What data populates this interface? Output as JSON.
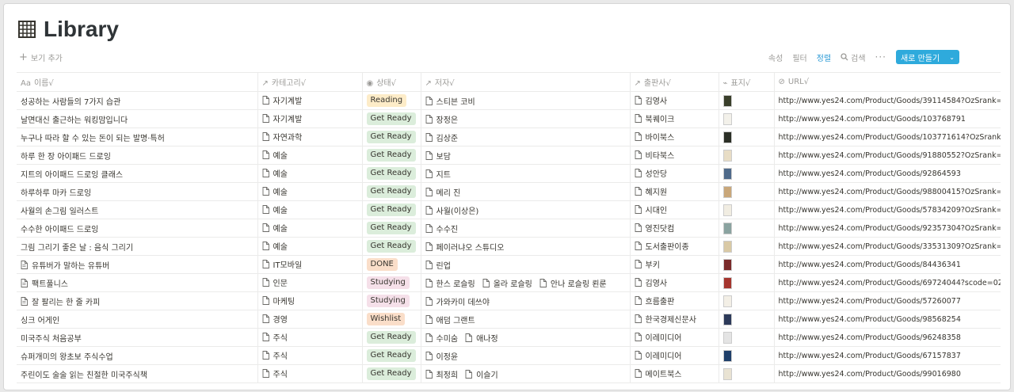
{
  "title": "Library",
  "add_view": "보기 추가",
  "toolbar": {
    "properties": "속성",
    "filter": "필터",
    "sort": "정렬",
    "search": "검색",
    "more": "···",
    "new_label": "새로 만들기"
  },
  "colors": {
    "accent": "#2eaadc",
    "reading_bg": "#fdecc8",
    "getready_bg": "#dbeddb",
    "done_bg": "#fadec9",
    "studying_bg": "#f5e0e9",
    "wishlist_bg": "#fadec9"
  },
  "columns": [
    "이름√",
    "카테고리√",
    "상태√",
    "저자√",
    "출판사√",
    "표지√",
    "URL√"
  ],
  "rows": [
    {
      "name": "성공하는 사람들의 7가지 습관",
      "doc": false,
      "category": "자기계발",
      "status": "Reading",
      "status_color": "#fdecc8",
      "authors": [
        "스티븐 코비"
      ],
      "publisher": "김영사",
      "cover": "#3a3f2b",
      "url": "http://www.yes24.com/Product/Goods/39114584?OzSrank=1"
    },
    {
      "name": "날면대신 출근하는 워킹맘입니다",
      "doc": false,
      "category": "자기계발",
      "status": "Get Ready",
      "status_color": "#dbeddb",
      "authors": [
        "장정은"
      ],
      "publisher": "북퀘이크",
      "cover": "#f3f1ea",
      "url": "http://www.yes24.com/Product/Goods/103768791"
    },
    {
      "name": "누구나 따라 할 수 있는 돈이 되는 발명·특허",
      "doc": false,
      "category": "자연과학",
      "status": "Get Ready",
      "status_color": "#dbeddb",
      "authors": [
        "김상준"
      ],
      "publisher": "바이북스",
      "cover": "#2b2f26",
      "url": "http://www.yes24.com/Product/Goods/103771614?OzSrank=1"
    },
    {
      "name": "하루 한 장 아이패드 드로잉",
      "doc": false,
      "category": "예술",
      "status": "Get Ready",
      "status_color": "#dbeddb",
      "authors": [
        "보담"
      ],
      "publisher": "비타북스",
      "cover": "#e8ddc5",
      "url": "http://www.yes24.com/Product/Goods/91880552?OzSrank=1"
    },
    {
      "name": "지트의 아이패드 드로잉 클래스",
      "doc": false,
      "category": "예술",
      "status": "Get Ready",
      "status_color": "#dbeddb",
      "authors": [
        "지트"
      ],
      "publisher": "성안당",
      "cover": "#4f6a8a",
      "url": "http://www.yes24.com/Product/Goods/92864593"
    },
    {
      "name": "하루하루 마카 드로잉",
      "doc": false,
      "category": "예술",
      "status": "Get Ready",
      "status_color": "#dbeddb",
      "authors": [
        "메리 진"
      ],
      "publisher": "혜지원",
      "cover": "#c9a77a",
      "url": "http://www.yes24.com/Product/Goods/98800415?OzSrank=1"
    },
    {
      "name": "사월의 손그림 일러스트",
      "doc": false,
      "category": "예술",
      "status": "Get Ready",
      "status_color": "#dbeddb",
      "authors": [
        "사월(이상은)"
      ],
      "publisher": "시대인",
      "cover": "#f1ede2",
      "url": "http://www.yes24.com/Product/Goods/57834209?OzSrank=1"
    },
    {
      "name": "수수한 아이패드 드로잉",
      "doc": false,
      "category": "예술",
      "status": "Get Ready",
      "status_color": "#dbeddb",
      "authors": [
        "수수진"
      ],
      "publisher": "영진닷컴",
      "cover": "#8aa3a0",
      "url": "http://www.yes24.com/Product/Goods/92357304?OzSrank=1"
    },
    {
      "name": "그림 그리기 좋은 날 : 음식 그리기",
      "doc": false,
      "category": "예술",
      "status": "Get Ready",
      "status_color": "#dbeddb",
      "authors": [
        "페이러냐오 스튜디오"
      ],
      "publisher": "도서출판이종",
      "cover": "#d9c9a5",
      "url": "http://www.yes24.com/Product/Goods/33531309?OzSrank=3"
    },
    {
      "name": "유튜버가 말하는 유튜버",
      "doc": true,
      "category": "IT모바일",
      "status": "DONE",
      "status_color": "#fadec9",
      "authors": [
        "린업"
      ],
      "publisher": "부키",
      "cover": "#7a2a2a",
      "url": "http://www.yes24.com/Product/Goods/84436341"
    },
    {
      "name": "팩트풀니스",
      "doc": true,
      "category": "인문",
      "status": "Studying",
      "status_color": "#f5e0e9",
      "authors": [
        "한스 로슬링",
        "올라 로슬링",
        "안나 로슬링 뢴룬"
      ],
      "publisher": "김영사",
      "cover": "#a5352e",
      "url": "http://www.yes24.com/Product/Goods/69724044?scode=029"
    },
    {
      "name": "잘 팔리는 한 줄 카피",
      "doc": true,
      "category": "마케팅",
      "status": "Studying",
      "status_color": "#f5e0e9",
      "authors": [
        "가와카미 데쓰야"
      ],
      "publisher": "흐름출판",
      "cover": "#f3efe6",
      "url": "http://www.yes24.com/Product/Goods/57260077"
    },
    {
      "name": "싱크 어게인",
      "doc": false,
      "category": "경영",
      "status": "Wishlist",
      "status_color": "#fadec9",
      "authors": [
        "애덤 그랜트"
      ],
      "publisher": "한국경제신문사",
      "cover": "#2d3a5a",
      "url": "http://www.yes24.com/Product/Goods/98568254"
    },
    {
      "name": "미국주식 처음공부",
      "doc": false,
      "category": "주식",
      "status": "Get Ready",
      "status_color": "#dbeddb",
      "authors": [
        "수미숨",
        "애나정"
      ],
      "publisher": "이레미디어",
      "cover": "#e4e4e4",
      "url": "http://www.yes24.com/Product/Goods/96248358"
    },
    {
      "name": "슈퍼개미의 왕초보 주식수업",
      "doc": false,
      "category": "주식",
      "status": "Get Ready",
      "status_color": "#dbeddb",
      "authors": [
        "이정윤"
      ],
      "publisher": "이레미디어",
      "cover": "#1f3f6a",
      "url": "http://www.yes24.com/Product/Goods/67157837"
    },
    {
      "name": "주린이도 술술 읽는 친절한 미국주식책",
      "doc": false,
      "category": "주식",
      "status": "Get Ready",
      "status_color": "#dbeddb",
      "authors": [
        "최정희",
        "이슬기"
      ],
      "publisher": "메이트북스",
      "cover": "#e9e3d3",
      "url": "http://www.yes24.com/Product/Goods/99016980"
    }
  ]
}
